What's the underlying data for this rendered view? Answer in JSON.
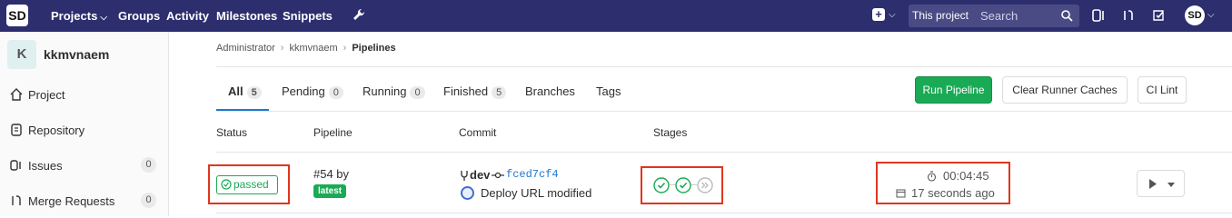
{
  "nav": {
    "logo": "SD",
    "projects": "Projects",
    "groups": "Groups",
    "activity": "Activity",
    "milestones": "Milestones",
    "snippets": "Snippets",
    "scope": "This project",
    "search_placeholder": "Search"
  },
  "sidebar": {
    "project_initial": "K",
    "project_name": "kkmvnaem",
    "items": [
      {
        "label": "Project",
        "icon": "home-icon"
      },
      {
        "label": "Repository",
        "icon": "document-icon"
      },
      {
        "label": "Issues",
        "icon": "issues-icon",
        "count": "0"
      },
      {
        "label": "Merge Requests",
        "icon": "merge-request-icon",
        "count": "0"
      }
    ]
  },
  "breadcrumb": [
    "Administrator",
    "kkmvnaem",
    "Pipelines"
  ],
  "tabs": [
    {
      "label": "All",
      "count": "5"
    },
    {
      "label": "Pending",
      "count": "0"
    },
    {
      "label": "Running",
      "count": "0"
    },
    {
      "label": "Finished",
      "count": "5"
    },
    {
      "label": "Branches"
    },
    {
      "label": "Tags"
    }
  ],
  "buttons": {
    "run_pipeline": "Run Pipeline",
    "clear_caches": "Clear Runner Caches",
    "ci_lint": "CI Lint"
  },
  "columns": [
    "Status",
    "Pipeline",
    "Commit",
    "Stages"
  ],
  "pipeline": {
    "status": "passed",
    "id_text": "#54 by",
    "tag": "latest",
    "branch": "dev",
    "sha": "fced7cf4",
    "commit_title": "Deploy URL modified",
    "stages": [
      "success",
      "success",
      "skipped"
    ],
    "duration": "00:04:45",
    "finished": "17 seconds ago"
  },
  "colors": {
    "nav_bg": "#2d2e6e",
    "success": "#1aaa55",
    "link": "#1f78d1",
    "highlight": "#e0361c"
  }
}
